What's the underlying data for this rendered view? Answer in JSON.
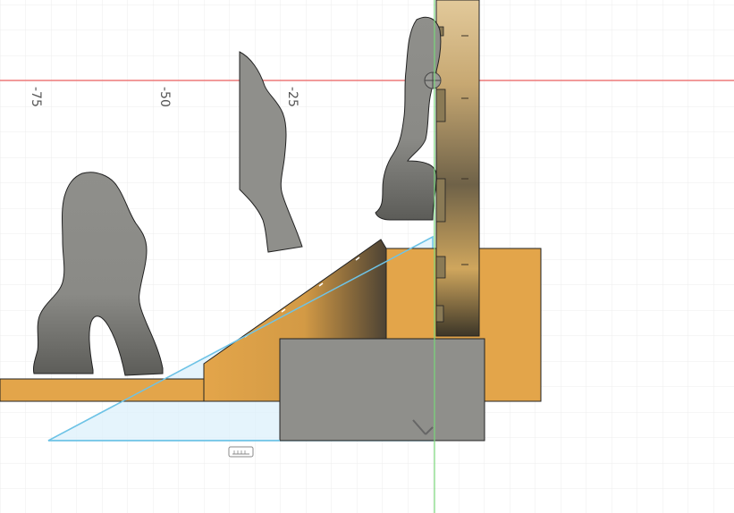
{
  "viewport": {
    "ruler_labels": [
      "-75",
      "-50",
      "-25"
    ],
    "colors": {
      "background": "#ffffff",
      "grid_minor": "#ececec",
      "grid_major": "#d9d9d9",
      "x_axis": "#f06464",
      "y_axis": "#7ad77a",
      "wood": "#e3a54a",
      "wood_dark": "#b07a2c",
      "wood_shadow": "#6a5836",
      "grey_body": "#8f8f8b",
      "grey_dark": "#5e5e5a",
      "sketch_line": "#6ec3e6",
      "sketch_fill": "#dff1fb",
      "outline": "#222222"
    },
    "icons": [
      "origin-marker-icon",
      "sketch-dimension-icon",
      "bend-tool-icon"
    ]
  }
}
